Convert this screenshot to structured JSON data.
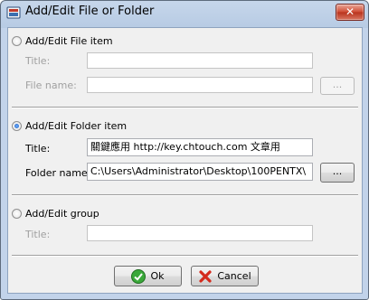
{
  "window": {
    "title": "Add/Edit File or Folder",
    "close_glyph": "✕"
  },
  "file_item": {
    "option_label": "Add/Edit File item",
    "title_label": "Title:",
    "title_value": "",
    "filename_label": "File name:",
    "filename_value": "",
    "browse_label": "..."
  },
  "folder_item": {
    "option_label": "Add/Edit Folder item",
    "title_label": "Title:",
    "title_value": "關鍵應用 http://key.chtouch.com 文章用",
    "foldername_label": "Folder name:",
    "foldername_value": "C:\\Users\\Administrator\\Desktop\\100PENTX\\",
    "browse_label": "..."
  },
  "group": {
    "option_label": "Add/Edit group",
    "title_label": "Title:",
    "title_value": ""
  },
  "buttons": {
    "ok_label": "Ok",
    "cancel_label": "Cancel"
  },
  "icons": {
    "app": "file-folder-app-icon",
    "ok": "green-check-icon",
    "cancel": "red-x-icon",
    "close": "close-icon"
  },
  "colors": {
    "title_bar": "#b7cbe4",
    "close_button": "#c8412b",
    "ok_icon": "#3aa83a",
    "cancel_icon": "#d42a1c"
  }
}
